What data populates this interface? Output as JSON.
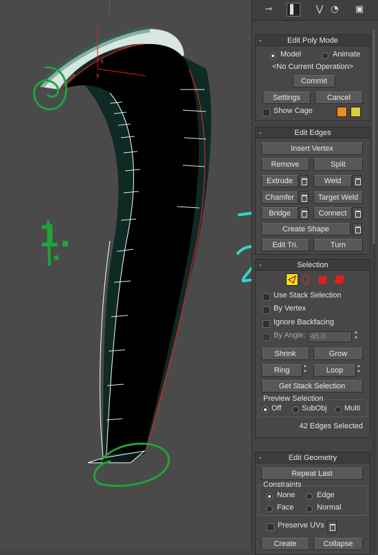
{
  "viewport": {
    "axis_x": "x",
    "axis_y": "y",
    "annotation_1": "1.",
    "annotation_2": "2",
    "colors": {
      "background": "#4a4a4a",
      "mesh_fill": "#000000",
      "mesh_side": "#0f2a24",
      "wire": "#ffffff",
      "selection": "#e02020",
      "green_marker": "#1ea43a",
      "cyan_marker": "#2fd8cc"
    }
  },
  "toolbar": {
    "icons": [
      "pin-icon",
      "modify-tab-icon",
      "subobject-icon",
      "light-icon",
      "display-icon"
    ]
  },
  "edit_poly_mode": {
    "title": "Edit Poly Mode",
    "model_label": "Model",
    "animate_label": "Animate",
    "operation_text": "<No Current Operation>",
    "commit_label": "Commit",
    "settings_label": "Settings",
    "cancel_label": "Cancel",
    "show_cage_label": "Show Cage",
    "cage_colors": [
      "#f08c1e",
      "#d8d23c"
    ]
  },
  "edit_edges": {
    "title": "Edit Edges",
    "insert_vertex": "Insert Vertex",
    "remove": "Remove",
    "split": "Split",
    "extrude": "Extrude",
    "weld": "Weld",
    "chamfer": "Chamfer",
    "target_weld": "Target Weld",
    "bridge": "Bridge",
    "connect": "Connect",
    "create_shape": "Create Shape",
    "edit_tri": "Edit Tri.",
    "turn": "Turn"
  },
  "selection": {
    "title": "Selection",
    "use_stack": "Use Stack Selection",
    "by_vertex": "By Vertex",
    "ignore_backfacing": "Ignore Backfacing",
    "by_angle": "By Angle:",
    "angle_value": "45.0",
    "shrink": "Shrink",
    "grow": "Grow",
    "ring": "Ring",
    "loop": "Loop",
    "get_stack": "Get Stack Selection",
    "preview_title": "Preview Selection",
    "preview_off": "Off",
    "preview_subobj": "SubObj",
    "preview_multi": "Multi",
    "status": "42 Edges Selected",
    "active_mode_color": "#e8e020"
  },
  "edit_geometry": {
    "title": "Edit Geometry",
    "repeat_last": "Repeat Last",
    "constraints_title": "Constraints",
    "none": "None",
    "edge": "Edge",
    "face": "Face",
    "normal": "Normal",
    "preserve_uvs": "Preserve UVs",
    "create": "Create",
    "collapse": "Collapse"
  }
}
